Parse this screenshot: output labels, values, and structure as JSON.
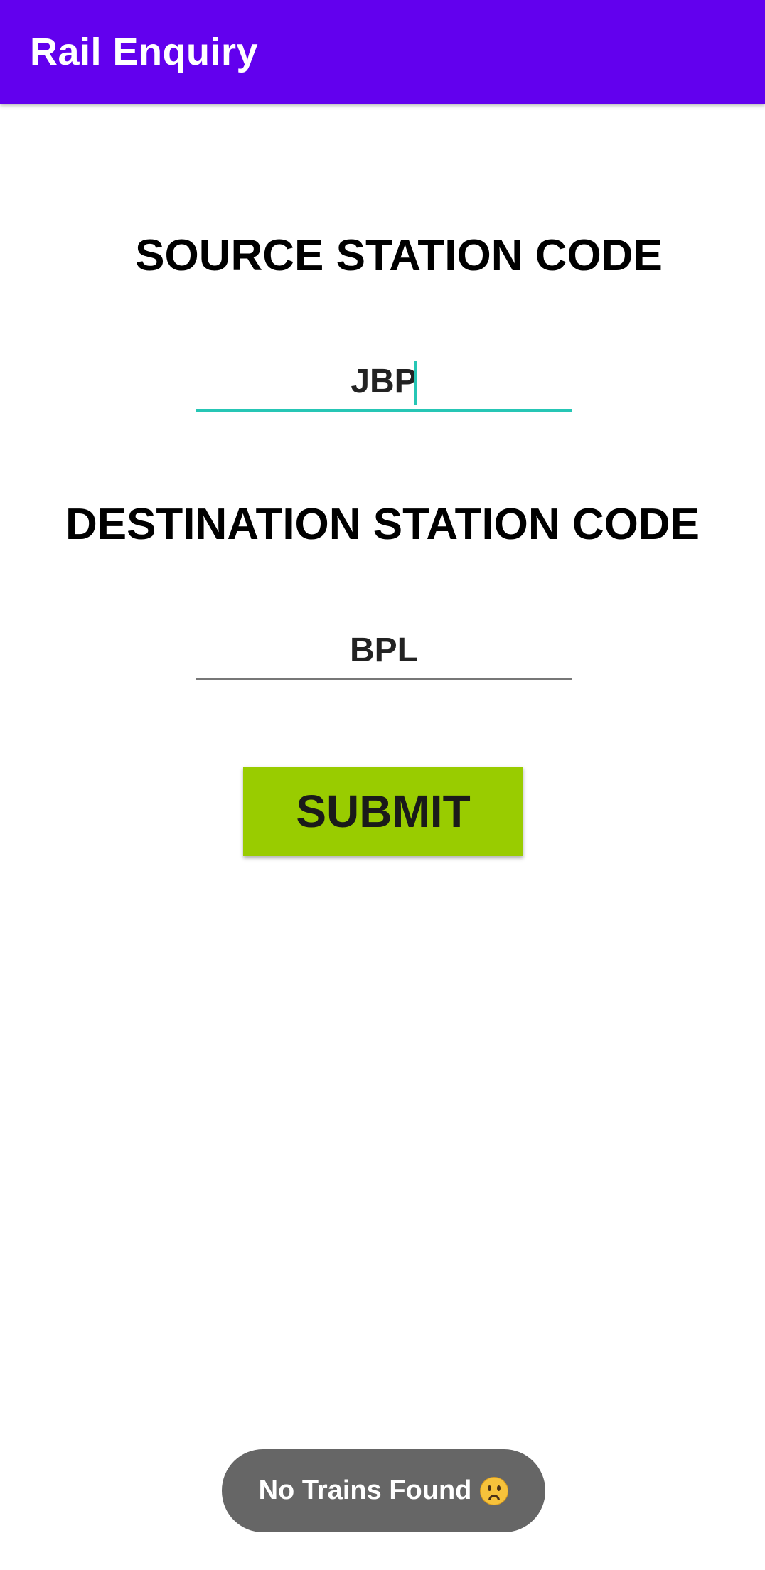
{
  "app_bar": {
    "title": "Rail Enquiry",
    "color": "#6200ee"
  },
  "form": {
    "source_label": "SOURCE STATION CODE",
    "source_value": "JBP",
    "destination_label": "DESTINATION STATION CODE",
    "destination_value": "BPL",
    "submit_label": "SUBMIT",
    "submit_color": "#99cc00",
    "focus_color": "#26c6b5"
  },
  "toast": {
    "message": "No Trains Found",
    "icon": "sad-face-emoji-icon"
  }
}
